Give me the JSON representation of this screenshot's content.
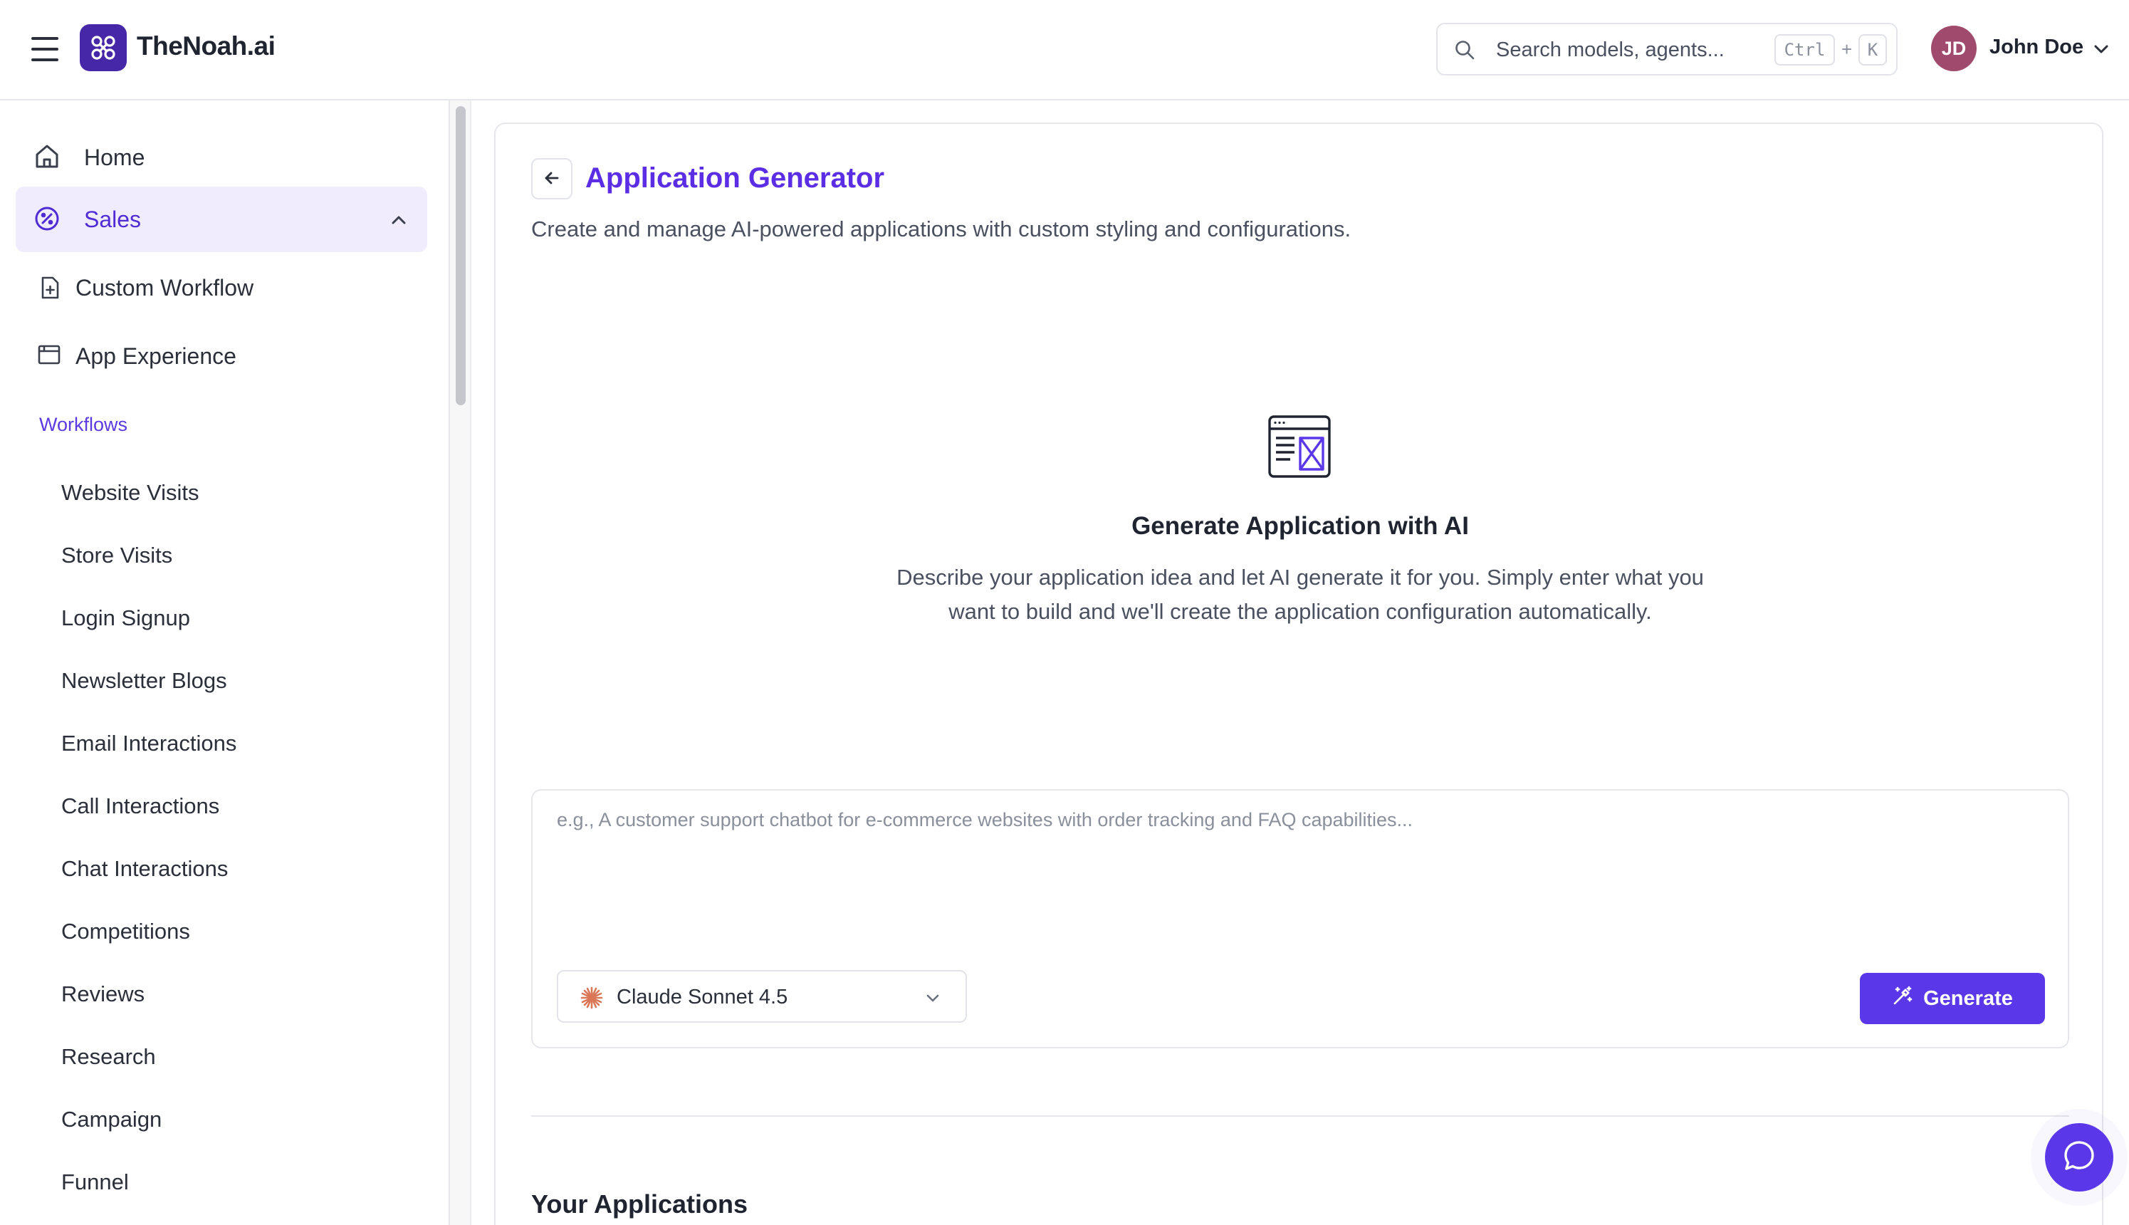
{
  "header": {
    "brand": "TheNoah.ai",
    "search_placeholder": "Search models, agents...",
    "shortcut_ctrl": "Ctrl",
    "shortcut_plus": "+",
    "shortcut_key": "K",
    "user_initials": "JD",
    "user_name": "John Doe"
  },
  "sidebar": {
    "home_label": "Home",
    "sales_label": "Sales",
    "sub_items": [
      "Custom Workflow",
      "App Experience"
    ],
    "section_label": "Workflows",
    "workflows": [
      "Website Visits",
      "Store Visits",
      "Login Signup",
      "Newsletter Blogs",
      "Email Interactions",
      "Call Interactions",
      "Chat Interactions",
      "Competitions",
      "Reviews",
      "Research",
      "Campaign",
      "Funnel"
    ]
  },
  "main": {
    "title": "Application Generator",
    "subtitle": "Create and manage AI-powered applications with custom styling and configurations.",
    "hero_title": "Generate Application with AI",
    "hero_description": "Describe your application idea and let AI generate it for you. Simply enter what you want to build and we'll create the application configuration automatically.",
    "prompt_placeholder": "e.g., A customer support chatbot for e-commerce websites with order tracking and FAQ capabilities...",
    "prompt_value": "",
    "model_selected": "Claude Sonnet 4.5",
    "generate_label": "Generate",
    "apps_section_title": "Your Applications"
  },
  "colors": {
    "accent": "#5b37ea",
    "accent_text": "#5b2ee6",
    "logo_bg": "#4527a8",
    "avatar_bg": "#a04b6e",
    "active_nav_bg": "#f0ecfd",
    "model_icon": "#d97757"
  },
  "icons": {
    "menu": "hamburger-icon",
    "logo": "logo-icon",
    "search": "search-icon",
    "user_menu": "chevron-down-icon",
    "home": "home-icon",
    "sales": "sales-badge-icon",
    "custom_workflow": "file-plus-icon",
    "app_experience": "browser-window-icon",
    "back": "arrow-left-icon",
    "hero": "app-layout-icon",
    "model": "claude-burst-icon",
    "generate": "magic-wand-icon",
    "chat": "chat-bubble-icon"
  }
}
